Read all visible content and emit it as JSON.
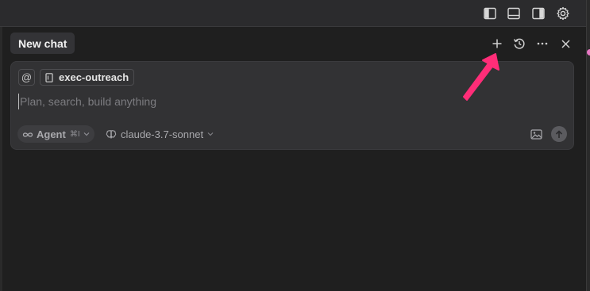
{
  "topbar": {
    "icons": [
      "sidebar-left-icon",
      "panel-bottom-icon",
      "sidebar-right-icon",
      "gear-icon"
    ]
  },
  "chat": {
    "tab_title": "New chat",
    "header_icons": [
      "plus-icon",
      "history-icon",
      "ellipsis-icon",
      "close-icon"
    ]
  },
  "composer": {
    "mention_symbol": "@",
    "context_file": "exec-outreach",
    "placeholder": "Plan, search, build anything",
    "mode": {
      "icon": "infinity-icon",
      "label": "Agent",
      "shortcut": "⌘I"
    },
    "model": {
      "icon": "brain-icon",
      "label": "claude-3.7-sonnet"
    }
  },
  "colors": {
    "background": "#1f1f1f",
    "composer": "#323234",
    "annotation_arrow": "#ff2d78"
  }
}
